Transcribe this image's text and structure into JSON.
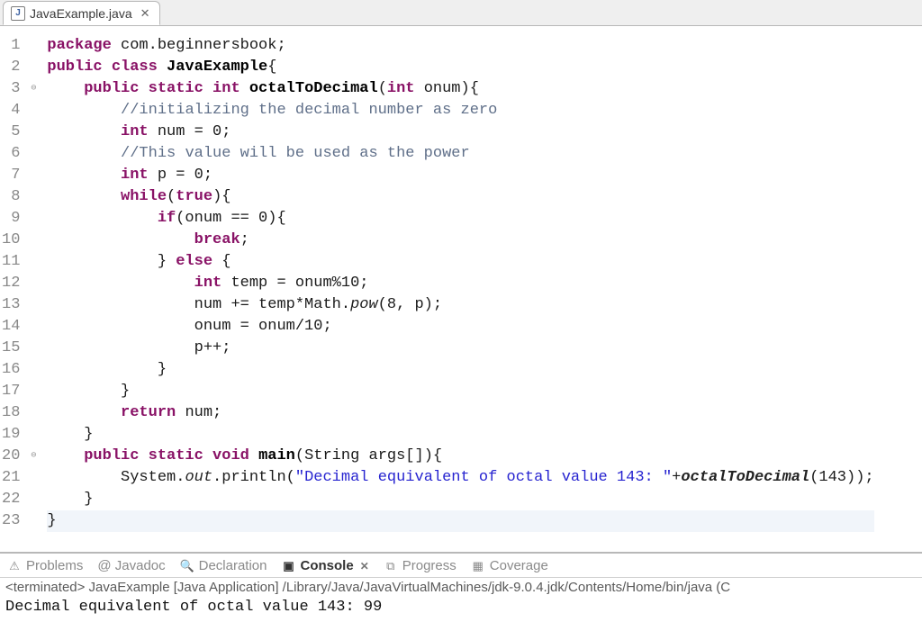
{
  "tab": {
    "filename": "JavaExample.java",
    "icon_letter": "J"
  },
  "code": {
    "lines": [
      {
        "n": 1,
        "fold": "",
        "segs": [
          [
            "kw",
            "package "
          ],
          [
            "nm",
            "com.beginnersbook;"
          ]
        ]
      },
      {
        "n": 2,
        "fold": "",
        "segs": [
          [
            "kw",
            "public class "
          ],
          [
            "bold",
            "JavaExample"
          ],
          [
            "nm",
            "{"
          ]
        ]
      },
      {
        "n": 3,
        "fold": "⊖",
        "segs": [
          [
            "nm",
            "    "
          ],
          [
            "kw",
            "public static "
          ],
          [
            "type",
            "int "
          ],
          [
            "bold",
            "octalToDecimal"
          ],
          [
            "nm",
            "("
          ],
          [
            "type",
            "int"
          ],
          [
            "nm",
            " onum){"
          ]
        ]
      },
      {
        "n": 4,
        "fold": "",
        "segs": [
          [
            "nm",
            "        "
          ],
          [
            "cmt",
            "//initializing the decimal number as zero"
          ]
        ]
      },
      {
        "n": 5,
        "fold": "",
        "segs": [
          [
            "nm",
            "        "
          ],
          [
            "type",
            "int"
          ],
          [
            "nm",
            " num = 0;"
          ]
        ]
      },
      {
        "n": 6,
        "fold": "",
        "segs": [
          [
            "nm",
            "        "
          ],
          [
            "cmt",
            "//This value will be used as the power"
          ]
        ]
      },
      {
        "n": 7,
        "fold": "",
        "segs": [
          [
            "nm",
            "        "
          ],
          [
            "type",
            "int"
          ],
          [
            "nm",
            " p = 0;"
          ]
        ]
      },
      {
        "n": 8,
        "fold": "",
        "segs": [
          [
            "nm",
            "        "
          ],
          [
            "kw",
            "while"
          ],
          [
            "nm",
            "("
          ],
          [
            "kw",
            "true"
          ],
          [
            "nm",
            "){"
          ]
        ]
      },
      {
        "n": 9,
        "fold": "",
        "segs": [
          [
            "nm",
            "            "
          ],
          [
            "kw",
            "if"
          ],
          [
            "nm",
            "(onum == 0){"
          ]
        ]
      },
      {
        "n": 10,
        "fold": "",
        "segs": [
          [
            "nm",
            "                "
          ],
          [
            "kw",
            "break"
          ],
          [
            "nm",
            ";"
          ]
        ]
      },
      {
        "n": 11,
        "fold": "",
        "segs": [
          [
            "nm",
            "            } "
          ],
          [
            "kw",
            "else"
          ],
          [
            "nm",
            " {"
          ]
        ]
      },
      {
        "n": 12,
        "fold": "",
        "segs": [
          [
            "nm",
            "                "
          ],
          [
            "type",
            "int"
          ],
          [
            "nm",
            " temp = onum%10;"
          ]
        ]
      },
      {
        "n": 13,
        "fold": "",
        "segs": [
          [
            "nm",
            "                num += temp*Math."
          ],
          [
            "it",
            "pow"
          ],
          [
            "nm",
            "(8, p);"
          ]
        ]
      },
      {
        "n": 14,
        "fold": "",
        "segs": [
          [
            "nm",
            "                onum = onum/10;"
          ]
        ]
      },
      {
        "n": 15,
        "fold": "",
        "segs": [
          [
            "nm",
            "                p++;"
          ]
        ]
      },
      {
        "n": 16,
        "fold": "",
        "segs": [
          [
            "nm",
            "            }"
          ]
        ]
      },
      {
        "n": 17,
        "fold": "",
        "segs": [
          [
            "nm",
            "        }"
          ]
        ]
      },
      {
        "n": 18,
        "fold": "",
        "segs": [
          [
            "nm",
            "        "
          ],
          [
            "kw",
            "return"
          ],
          [
            "nm",
            " num;"
          ]
        ]
      },
      {
        "n": 19,
        "fold": "",
        "segs": [
          [
            "nm",
            "    }"
          ]
        ]
      },
      {
        "n": 20,
        "fold": "⊖",
        "segs": [
          [
            "nm",
            "    "
          ],
          [
            "kw",
            "public static "
          ],
          [
            "type",
            "void "
          ],
          [
            "bold",
            "main"
          ],
          [
            "nm",
            "(String args[]){"
          ]
        ]
      },
      {
        "n": 21,
        "fold": "",
        "segs": [
          [
            "nm",
            "        System."
          ],
          [
            "it",
            "out"
          ],
          [
            "nm",
            ".println("
          ],
          [
            "str",
            "\"Decimal equivalent of octal value 143: \""
          ],
          [
            "nm",
            "+"
          ],
          [
            "it bold",
            "octalToDecimal"
          ],
          [
            "nm",
            "(143));"
          ]
        ]
      },
      {
        "n": 22,
        "fold": "",
        "segs": [
          [
            "nm",
            "    }"
          ]
        ]
      },
      {
        "n": 23,
        "fold": "",
        "segs": [
          [
            "nm",
            "}"
          ]
        ]
      }
    ]
  },
  "views": {
    "problems": "Problems",
    "javadoc": "@ Javadoc",
    "declaration": "Declaration",
    "console": "Console",
    "progress": "Progress",
    "coverage": "Coverage"
  },
  "console": {
    "header": "<terminated> JavaExample [Java Application] /Library/Java/JavaVirtualMachines/jdk-9.0.4.jdk/Contents/Home/bin/java (C",
    "output": "Decimal equivalent of octal value 143: 99"
  }
}
